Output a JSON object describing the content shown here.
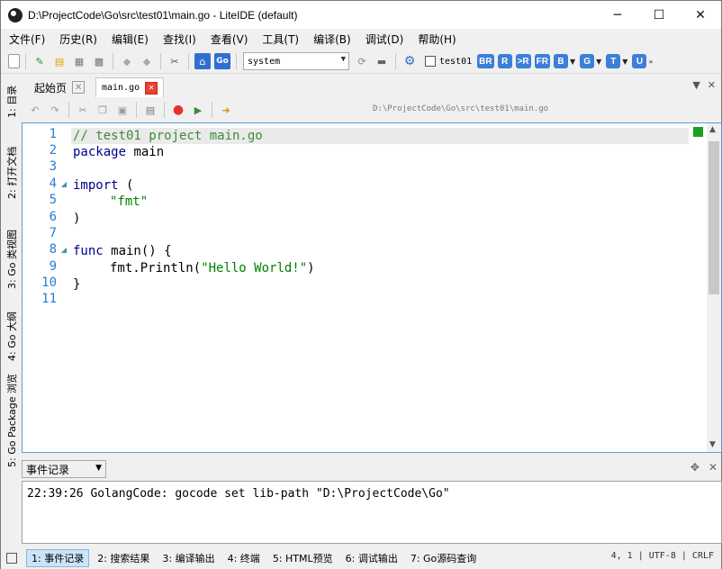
{
  "window": {
    "title": "D:\\ProjectCode\\Go\\src\\test01\\main.go - LiteIDE (default)",
    "minimize": "─",
    "maximize": "☐",
    "close": "✕"
  },
  "menu": [
    "文件(F)",
    "历史(R)",
    "编辑(E)",
    "查找(I)",
    "查看(V)",
    "工具(T)",
    "编译(B)",
    "调试(D)",
    "帮助(H)"
  ],
  "toolbar": {
    "env_combo": "system",
    "build_target_label": "test01",
    "build_buttons": [
      "BR",
      "R",
      ">R",
      "FR",
      "B",
      "G",
      "T",
      "U"
    ]
  },
  "left_tabs": [
    "1: 目录",
    "2: 打开文档",
    "3: Go 类视图",
    "4: Go 大纲",
    "5: Go Package 浏览"
  ],
  "tabs": [
    {
      "label": "起始页",
      "close": "✕"
    },
    {
      "label": "main.go",
      "close": "✕"
    }
  ],
  "editor": {
    "path": "D:\\ProjectCode\\Go\\src\\test01\\main.go",
    "lines": [
      "1",
      "2",
      "3",
      "4",
      "5",
      "6",
      "7",
      "8",
      "9",
      "10",
      "11"
    ],
    "code": {
      "l1": "// test01 project main.go",
      "l2_kw": "package",
      "l2_rest": " main",
      "l4_kw": "import",
      "l4_rest": " (",
      "l5_str": "\"fmt\"",
      "l6": ")",
      "l8_kw": "func",
      "l8_rest": " main() {",
      "l9_pre": "fmt.Println(",
      "l9_str": "\"Hello World!\"",
      "l9_post": ")",
      "l10": "}"
    }
  },
  "output": {
    "combo": "事件记录",
    "text": "22:39:26 GolangCode: gocode set lib-path \"D:\\ProjectCode\\Go\""
  },
  "status_tabs": [
    "1: 事件记录",
    "2: 搜索结果",
    "3: 编译输出",
    "4: 终端",
    "5: HTML预览",
    "6: 调试输出",
    "7: Go源码查询"
  ],
  "status_right": "4, 1 | UTF-8 | CRLF",
  "colors": {
    "accent_blue": "#3b7fd9",
    "line_number": "#2b7bd1",
    "keyword": "#00008b",
    "string": "#008000"
  }
}
